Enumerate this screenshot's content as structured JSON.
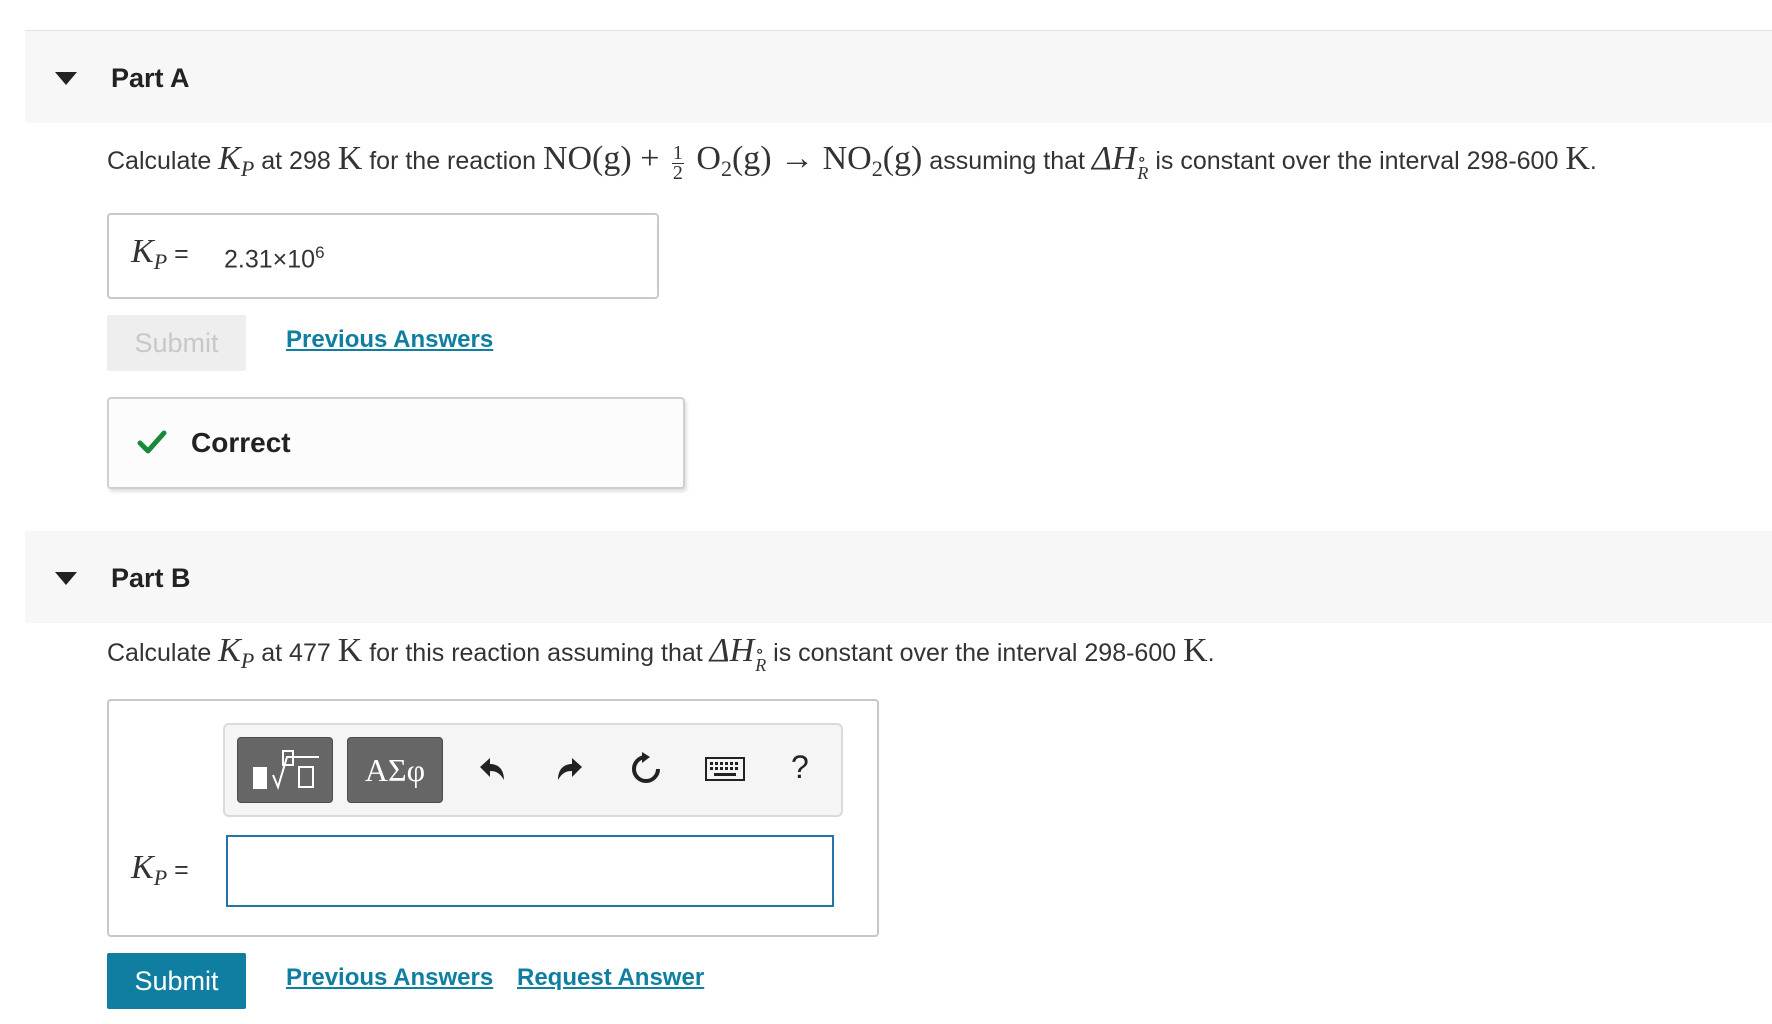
{
  "partA": {
    "title": "Part A",
    "question": {
      "t1": "Calculate ",
      "kp": "K",
      "kp_sub": "P",
      "t2": " at 298 ",
      "unitK": "K",
      "t3": " for the reaction ",
      "no": "NO(g) + ",
      "frac_num": "1",
      "frac_den": "2",
      "o2": " O",
      "o2_sub": "2",
      "o2_g": "(g) → NO",
      "no2_sub": "2",
      "no2_g": "(g)",
      "t4": " assuming that ",
      "dh": "ΔH",
      "dh_sup": "∘",
      "dh_sub": "R",
      "t5": " is constant over the interval 298-600 ",
      "unitK2": "K",
      "t6": "."
    },
    "answer_label_k": "K",
    "answer_label_sub": "P",
    "answer_label_eq": " =",
    "answer_value": "2.31×10",
    "answer_exp": "6",
    "submit_label": "Submit",
    "previous_answers": "Previous Answers",
    "feedback": "Correct",
    "feedback_color": "#1a8a3a"
  },
  "partB": {
    "title": "Part B",
    "question": {
      "t1": "Calculate ",
      "kp": "K",
      "kp_sub": "P",
      "t2": " at 477 ",
      "unitK": "K",
      "t3": " for this reaction assuming that ",
      "dh": "ΔH",
      "dh_sup": "∘",
      "dh_sub": "R",
      "t4": " is constant over the interval 298-600 ",
      "unitK2": "K",
      "t5": "."
    },
    "toolbar": {
      "templates_icon": "template-icon",
      "greek_label": "ΑΣφ",
      "undo_icon": "undo-icon",
      "redo_icon": "redo-icon",
      "reset_icon": "reset-icon",
      "keyboard_icon": "keyboard-icon",
      "help_label": "?"
    },
    "input_label_k": "K",
    "input_label_sub": "P",
    "input_label_eq": " =",
    "input_value": "",
    "submit_label": "Submit",
    "previous_answers": "Previous Answers",
    "request_answer": "Request Answer"
  },
  "colors": {
    "link": "#0f7ea1",
    "submit_bg": "#0f7ea1",
    "input_border": "#2574a9"
  }
}
